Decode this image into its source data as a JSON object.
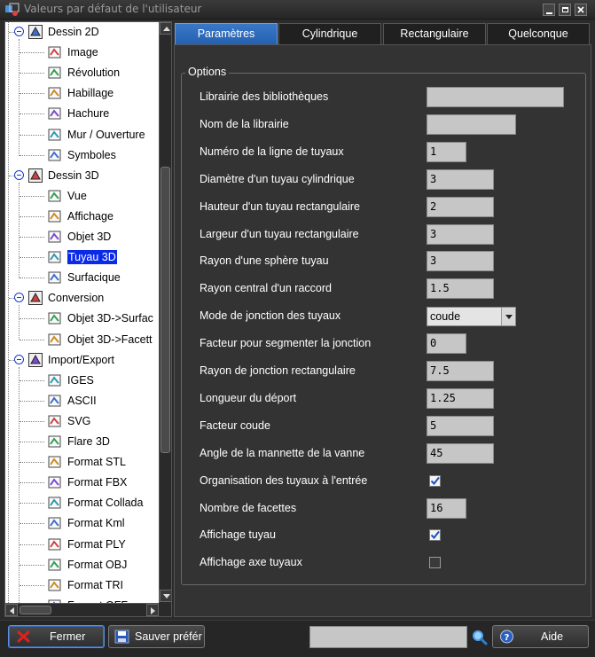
{
  "window": {
    "title": "Valeurs par défaut de l'utilisateur"
  },
  "tree": {
    "items": [
      {
        "label": "Dessin 2D",
        "icon": "drawing-2d-icon",
        "level": 0
      },
      {
        "label": "Image",
        "icon": "image-icon",
        "level": 1
      },
      {
        "label": "Révolution",
        "icon": "revolution-icon",
        "level": 1
      },
      {
        "label": "Habillage",
        "icon": "dressing-icon",
        "level": 1
      },
      {
        "label": "Hachure",
        "icon": "hatch-icon",
        "level": 1
      },
      {
        "label": "Mur / Ouverture",
        "icon": "wall-icon",
        "level": 1
      },
      {
        "label": "Symboles",
        "icon": "symbols-icon",
        "level": 1
      },
      {
        "label": "Dessin 3D",
        "icon": "drawing-3d-icon",
        "level": 0
      },
      {
        "label": "Vue",
        "icon": "view-icon",
        "level": 1
      },
      {
        "label": "Affichage",
        "icon": "display-icon",
        "level": 1
      },
      {
        "label": "Objet 3D",
        "icon": "object-3d-icon",
        "level": 1
      },
      {
        "label": "Tuyau 3D",
        "icon": "pipe-3d-icon",
        "level": 1,
        "selected": true
      },
      {
        "label": "Surfacique",
        "icon": "surface-icon",
        "level": 1
      },
      {
        "label": "Conversion",
        "icon": "conversion-icon",
        "level": 0
      },
      {
        "label": "Objet 3D->Surfac",
        "icon": "object-to-surface-icon",
        "level": 1
      },
      {
        "label": "Objet 3D->Facett",
        "icon": "object-to-facet-icon",
        "level": 1
      },
      {
        "label": "Import/Export",
        "icon": "import-export-icon",
        "level": 0
      },
      {
        "label": "IGES",
        "icon": "iges-icon",
        "level": 1
      },
      {
        "label": "ASCII",
        "icon": "ascii-icon",
        "level": 1
      },
      {
        "label": "SVG",
        "icon": "svg-icon",
        "level": 1
      },
      {
        "label": "Flare 3D",
        "icon": "flare3d-icon",
        "level": 1
      },
      {
        "label": "Format STL",
        "icon": "stl-icon",
        "level": 1
      },
      {
        "label": "Format FBX",
        "icon": "fbx-icon",
        "level": 1
      },
      {
        "label": "Format Collada",
        "icon": "collada-icon",
        "level": 1
      },
      {
        "label": "Format Kml",
        "icon": "kml-icon",
        "level": 1
      },
      {
        "label": "Format PLY",
        "icon": "ply-icon",
        "level": 1
      },
      {
        "label": "Format OBJ",
        "icon": "obj-icon",
        "level": 1
      },
      {
        "label": "Format TRI",
        "icon": "tri-icon",
        "level": 1
      },
      {
        "label": "Format OFF",
        "icon": "off-icon",
        "level": 1
      }
    ]
  },
  "tabs": [
    {
      "label": "Paramètres",
      "active": true
    },
    {
      "label": "Cylindrique",
      "active": false
    },
    {
      "label": "Rectangulaire",
      "active": false
    },
    {
      "label": "Quelconque",
      "active": false
    }
  ],
  "options": {
    "group_title": "Options",
    "fields": [
      {
        "label": "Librairie des bibliothèques",
        "type": "text",
        "value": ""
      },
      {
        "label": "Nom de la librairie",
        "type": "text",
        "value": ""
      },
      {
        "label": "Numéro de la ligne de tuyaux",
        "type": "text",
        "value": "1"
      },
      {
        "label": "Diamètre d'un tuyau cylindrique",
        "type": "text",
        "value": "3"
      },
      {
        "label": "Hauteur d'un tuyau rectangulaire",
        "type": "text",
        "value": "2"
      },
      {
        "label": "Largeur d'un tuyau rectangulaire",
        "type": "text",
        "value": "3"
      },
      {
        "label": "Rayon d'une sphère tuyau",
        "type": "text",
        "value": "3"
      },
      {
        "label": "Rayon central d'un raccord",
        "type": "text",
        "value": "1.5"
      },
      {
        "label": "Mode de jonction des tuyaux",
        "type": "select",
        "value": "coude"
      },
      {
        "label": "Facteur pour segmenter la jonction",
        "type": "text",
        "value": "0"
      },
      {
        "label": "Rayon de jonction rectangulaire",
        "type": "text",
        "value": "7.5"
      },
      {
        "label": "Longueur du déport",
        "type": "text",
        "value": "1.25"
      },
      {
        "label": "Facteur coude",
        "type": "text",
        "value": "5"
      },
      {
        "label": "Angle de la mannette de la vanne",
        "type": "text",
        "value": "45"
      },
      {
        "label": "Organisation des tuyaux à l'entrée",
        "type": "checkbox",
        "checked": true
      },
      {
        "label": "Nombre de facettes",
        "type": "text",
        "value": "16"
      },
      {
        "label": "Affichage tuyau",
        "type": "checkbox",
        "checked": true
      },
      {
        "label": "Affichage axe tuyaux",
        "type": "checkbox",
        "checked": false
      }
    ]
  },
  "footer": {
    "close_label": "Fermer",
    "save_label": "Sauver préfér",
    "search_value": "",
    "help_label": "Aide"
  },
  "colors": {
    "accent": "#2a6bc0",
    "selection": "#0a2ae8",
    "background": "#2b2b2b"
  }
}
